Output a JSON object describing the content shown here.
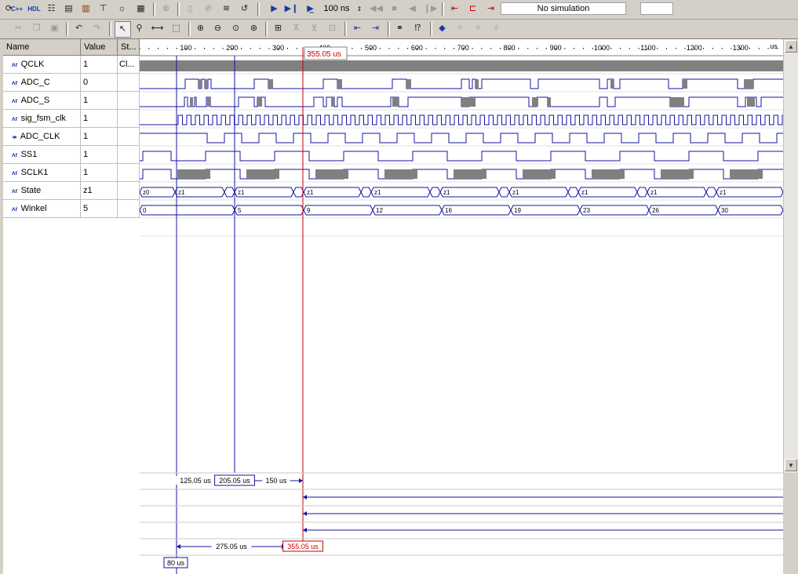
{
  "toolbar": {
    "time_step": "100 ns",
    "status": "No simulation"
  },
  "columns": {
    "name": "Name",
    "value": "Value",
    "status": "St..."
  },
  "signals": [
    {
      "name": "QCLK",
      "value": "1",
      "status": "Cl...",
      "icon": "input-signal-icon"
    },
    {
      "name": "ADC_C",
      "value": "0",
      "status": "",
      "icon": "input-signal-icon"
    },
    {
      "name": "ADC_S",
      "value": "1",
      "status": "",
      "icon": "input-signal-icon"
    },
    {
      "name": "sig_fsm_clk",
      "value": "1",
      "status": "",
      "icon": "input-signal-icon"
    },
    {
      "name": "ADC_CLK",
      "value": "1",
      "status": "",
      "icon": "output-signal-icon"
    },
    {
      "name": "SS1",
      "value": "1",
      "status": "",
      "icon": "input-signal-icon"
    },
    {
      "name": "SCLK1",
      "value": "1",
      "status": "",
      "icon": "input-signal-icon"
    },
    {
      "name": "State",
      "value": "z1",
      "status": "",
      "icon": "input-signal-icon"
    },
    {
      "name": "Winkel",
      "value": "5",
      "status": "",
      "icon": "input-signal-icon"
    }
  ],
  "ruler": {
    "unit": "us",
    "ticks": [
      "100",
      "200",
      "300",
      "400",
      "500",
      "600",
      "700",
      "800",
      "900",
      "1000",
      "1100",
      "1200",
      "1300"
    ],
    "cursor_label": "355.05 us"
  },
  "state_bus": [
    "z0",
    "z1",
    "z1",
    "z1",
    "z1",
    "z1",
    "z1",
    "z1",
    "z1",
    "z1"
  ],
  "winkel_bus": [
    "0",
    "5",
    "9",
    "12",
    "16",
    "19",
    "23",
    "26",
    "30"
  ],
  "measurements": {
    "m1": "125.05 us",
    "m2": "205.05 us",
    "m3": "150 us",
    "m4": "275.05 us",
    "m5": "355.05 us",
    "m6": "80 us"
  },
  "colors": {
    "wave": "#1414a0",
    "cursor_blue": "#1414a0",
    "cursor_red": "#c80000",
    "bus_fill": "#808080"
  }
}
